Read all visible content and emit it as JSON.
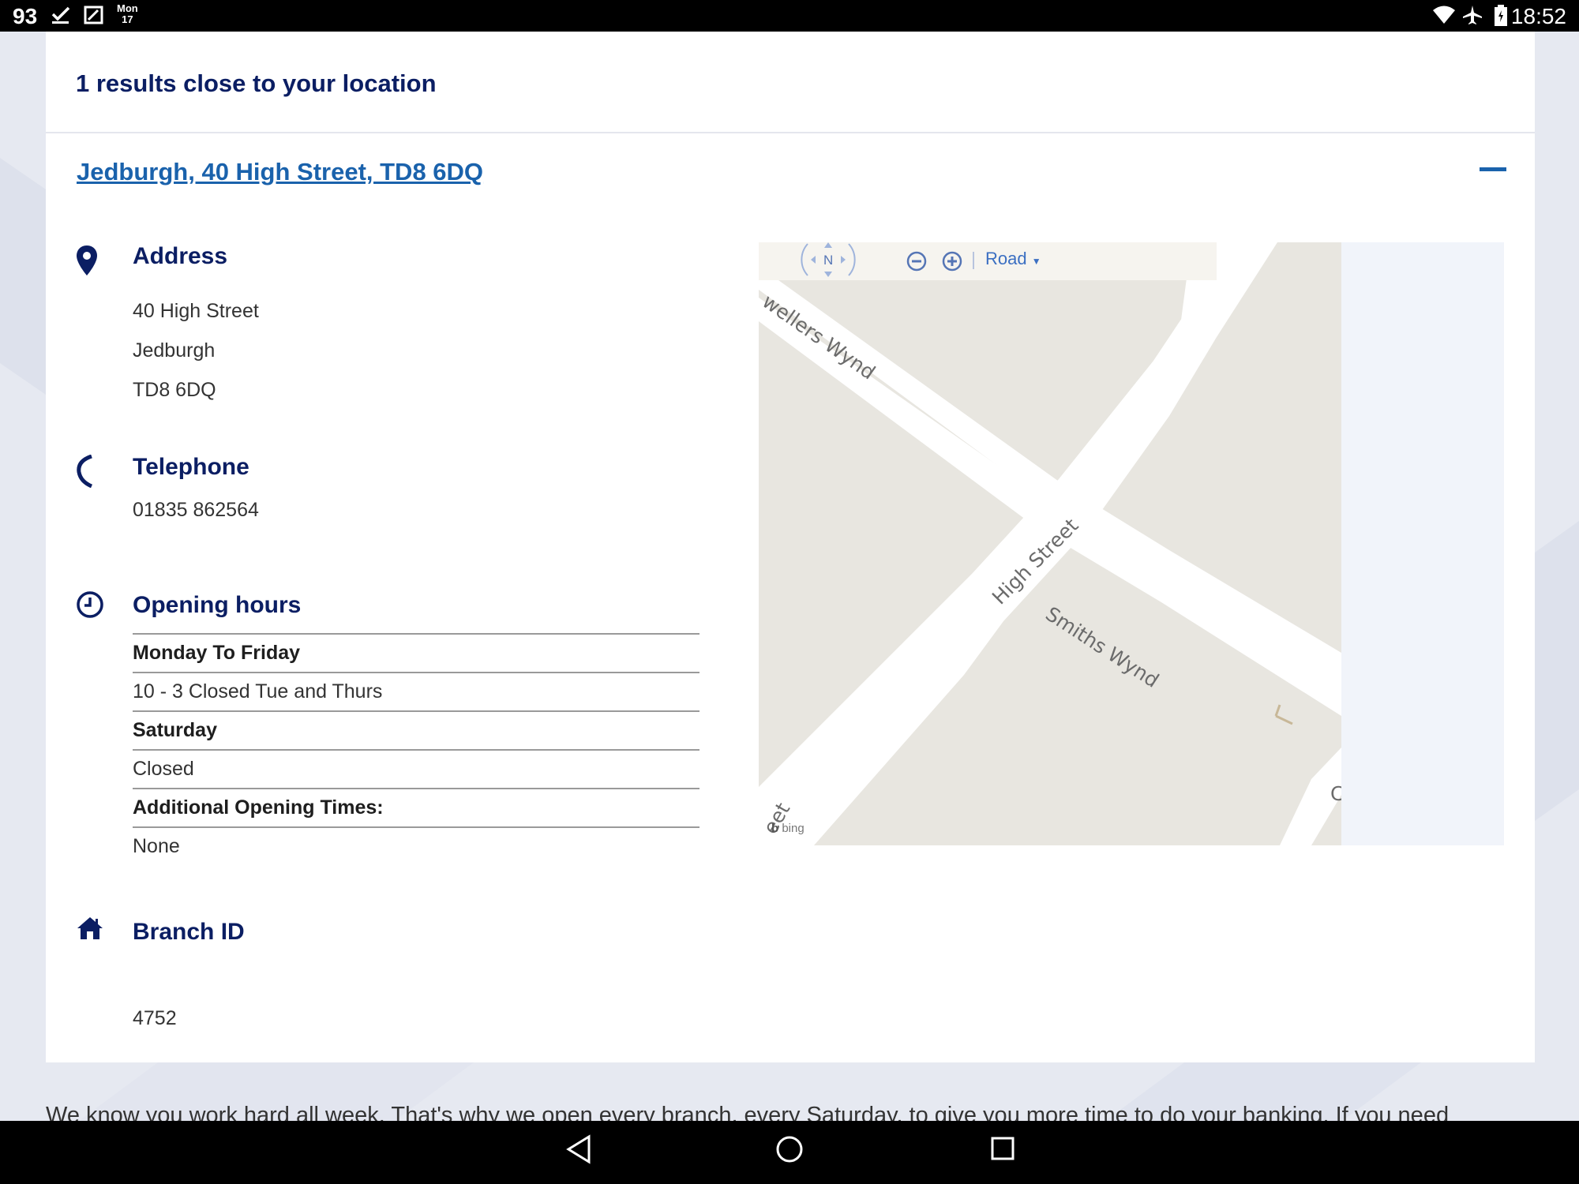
{
  "status_bar": {
    "notification_count": "93",
    "date_day": "Mon",
    "date_num": "17",
    "time": "18:52"
  },
  "results_title": "1 results close to your location",
  "branch": {
    "link": "Jedburgh, 40 High Street, TD8 6DQ",
    "address_title": "Address",
    "address_lines": [
      "40 High Street",
      "Jedburgh",
      "TD8 6DQ"
    ],
    "telephone_title": "Telephone",
    "telephone": "01835 862564",
    "hours_title": "Opening hours",
    "hours": [
      {
        "label": "Monday To Friday",
        "value": "10 - 3 Closed Tue and Thurs"
      },
      {
        "label": "Saturday",
        "value": "Closed"
      },
      {
        "label": "Additional Opening Times:",
        "value": "None"
      }
    ],
    "branch_id_title": "Branch ID",
    "branch_id": "4752"
  },
  "map": {
    "compass_label": "N",
    "view_mode": "Road",
    "streets": [
      "wellers Wynd",
      "High Street",
      "Smiths Wynd",
      "eet",
      "C"
    ],
    "attribution": "bing"
  },
  "footer_text": "We know you work hard all week. That's why we open every branch, every Saturday, to give you more time to do your banking. If you need",
  "colors": {
    "accent": "#1a62ac",
    "heading": "#0b1e63",
    "background": "#e6e9f1"
  }
}
